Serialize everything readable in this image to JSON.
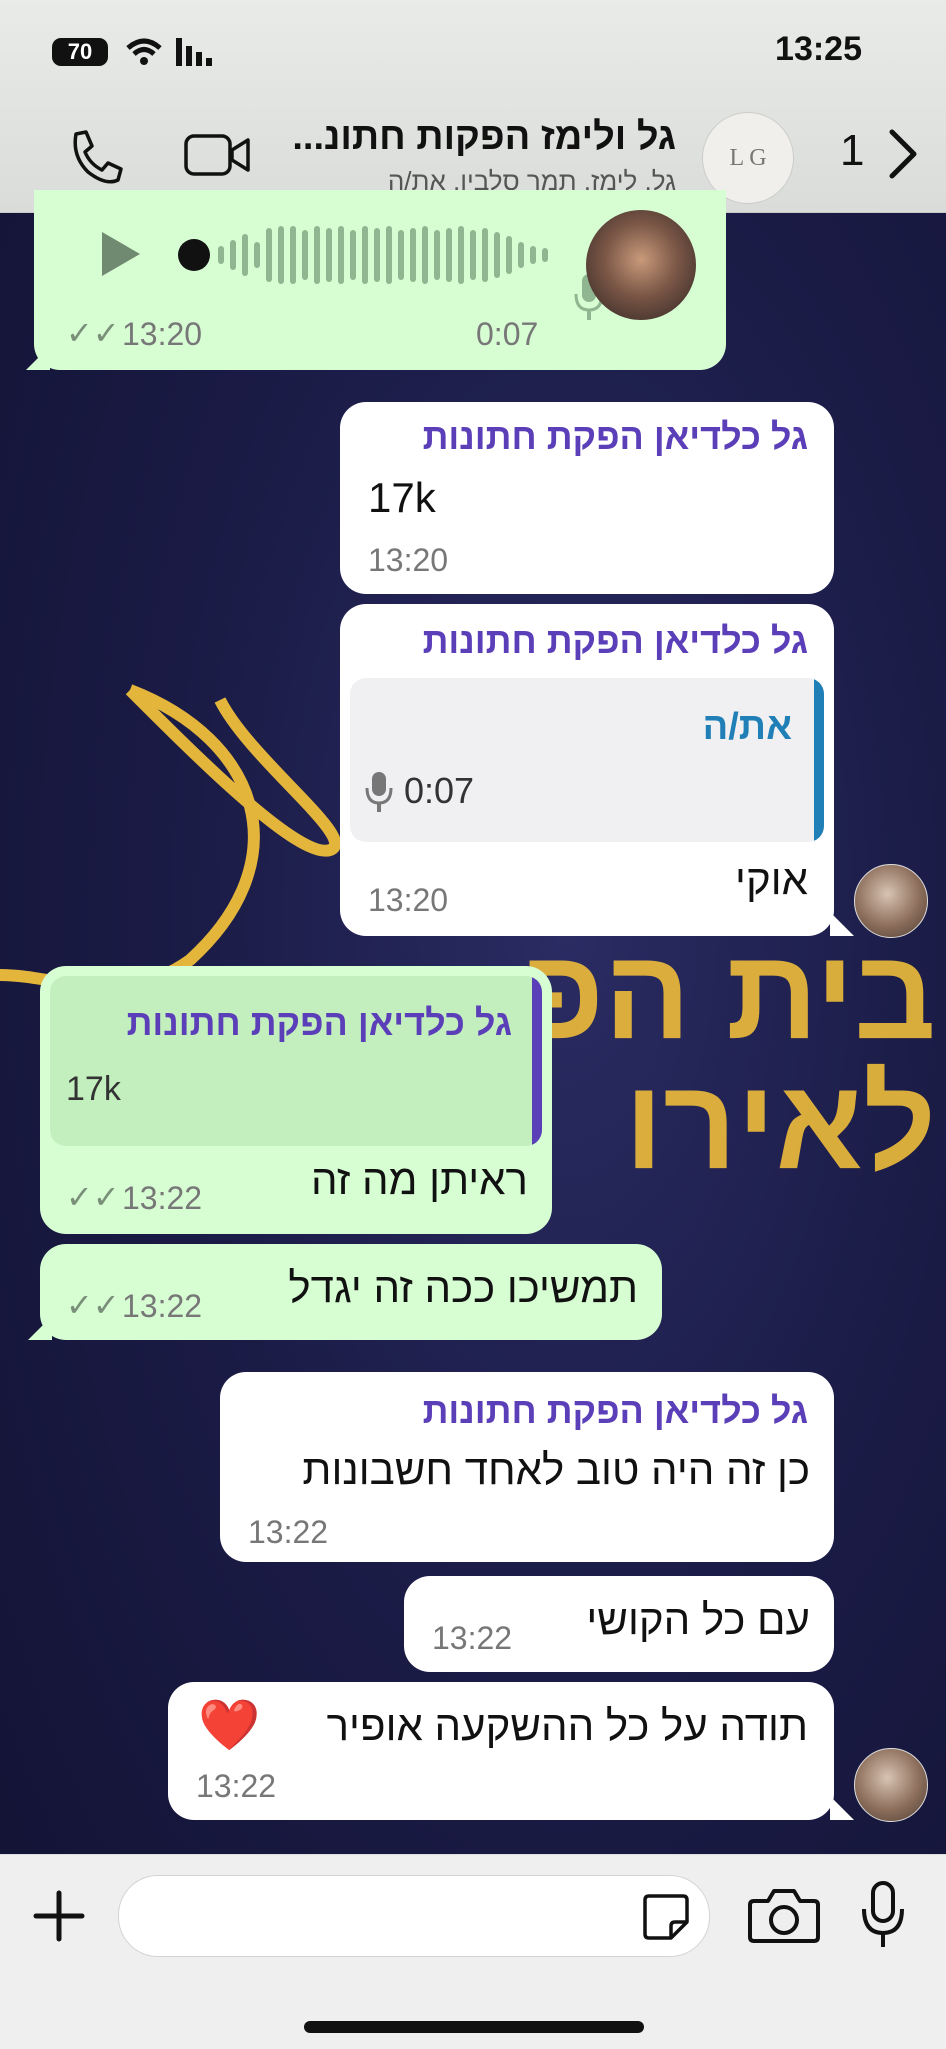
{
  "status_bar": {
    "time": "13:25",
    "battery": "70"
  },
  "header": {
    "title": "גל ולימז הפקות חתונ...",
    "subtitle": "גל, לימז, תמר סלבין, את/ה",
    "back_count": "1",
    "group_avatar_text": "L G"
  },
  "wallpaper": {
    "line1": "בית הפ",
    "line2": "לאירו"
  },
  "messages": [
    {
      "voice_time": "13:20",
      "voice_duration": "0:07"
    },
    {
      "sender": "גל כלדיאן הפקת חתונות",
      "text": "17k",
      "time": "13:20"
    },
    {
      "sender": "גל כלדיאן הפקת חתונות",
      "quote_author": "את/ה",
      "quote_text": "0:07",
      "text": "אוקי",
      "time": "13:20"
    },
    {
      "quote_author": "גל כלדיאן הפקת חתונות",
      "quote_text": "17k",
      "text": "ראיתן מה זה",
      "time": "13:22"
    },
    {
      "text": "תמשיכו ככה זה יגדל",
      "time": "13:22"
    },
    {
      "sender": "גל כלדיאן הפקת חתונות",
      "text": "כן זה היה טוב לאחד חשבונות",
      "time": "13:22"
    },
    {
      "text": "עם כל הקושי",
      "time": "13:22"
    },
    {
      "text": "תודה על כל ההשקעה אופיר",
      "time": "13:22",
      "emoji": "❤️"
    }
  ],
  "colors": {
    "outgoing": "#d7fdd3",
    "incoming": "#ffffff",
    "sender": "#5b3fb8",
    "quote_bar_self": "#1f7fb6",
    "quote_bar_other": "#5b3fb8",
    "wallpaper_accent": "#e4b53b"
  },
  "icons": [
    "phone-icon",
    "video-icon",
    "chevron-right-icon",
    "plus-icon",
    "sticker-icon",
    "camera-icon",
    "microphone-icon",
    "play-icon",
    "double-check-icon",
    "wifi-icon",
    "signal-icon"
  ]
}
